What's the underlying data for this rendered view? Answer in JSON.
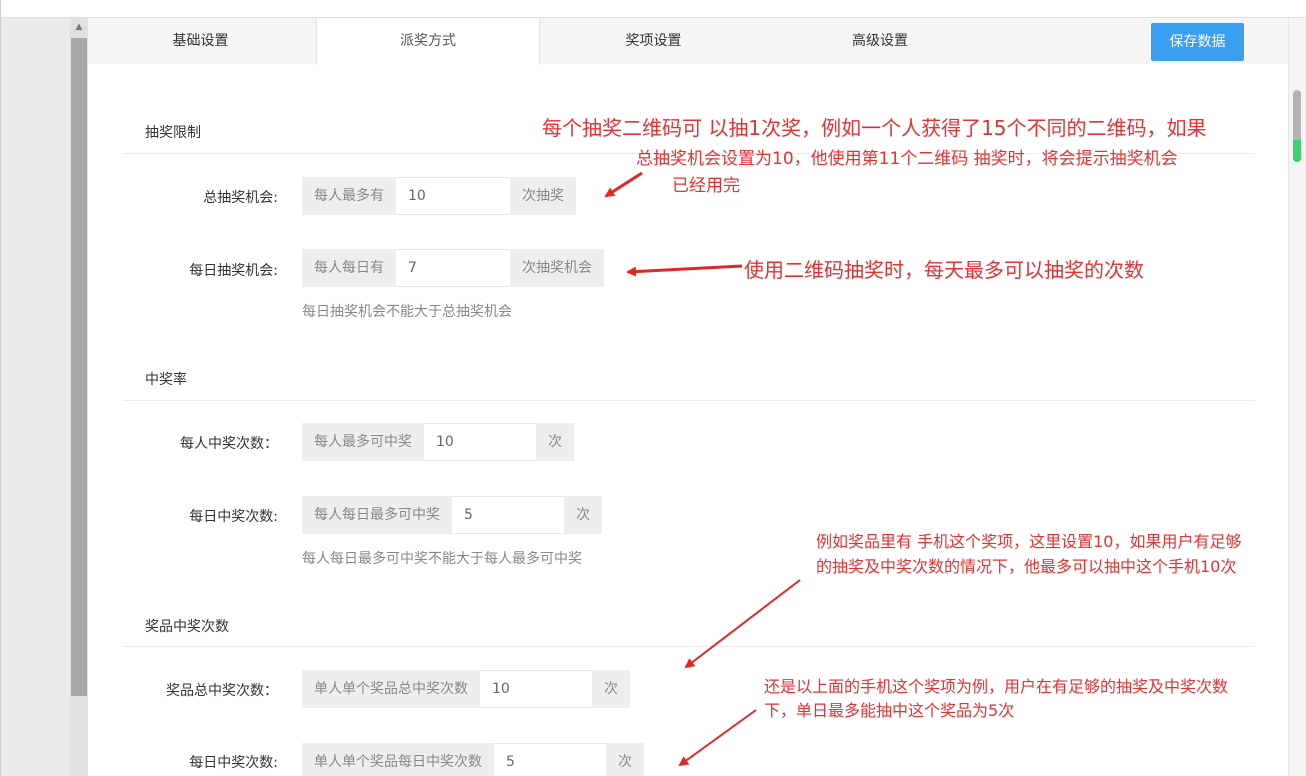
{
  "tabs": [
    {
      "label": "基础设置",
      "active": false
    },
    {
      "label": "派奖方式",
      "active": true
    },
    {
      "label": "奖项设置",
      "active": false
    },
    {
      "label": "高级设置",
      "active": false
    }
  ],
  "save_button": "保存数据",
  "sections": {
    "limit": {
      "title": "抽奖限制",
      "total": {
        "label": "总抽奖机会:",
        "prefix": "每人最多有",
        "value": "10",
        "suffix": "次抽奖"
      },
      "daily": {
        "label": "每日抽奖机会:",
        "prefix": "每人每日有",
        "value": "7",
        "suffix": "次抽奖机会",
        "hint": "每日抽奖机会不能大于总抽奖机会"
      }
    },
    "rate": {
      "title": "中奖率",
      "per_person": {
        "label": "每人中奖次数：",
        "prefix": "每人最多可中奖",
        "value": "10",
        "suffix": "次"
      },
      "daily": {
        "label": "每日中奖次数:",
        "prefix": "每人每日最多可中奖",
        "value": "5",
        "suffix": "次",
        "hint": "每人每日最多可中奖不能大于每人最多可中奖"
      }
    },
    "prize": {
      "title": "奖品中奖次数",
      "total": {
        "label": "奖品总中奖次数：",
        "prefix": "单人单个奖品总中奖次数",
        "value": "10",
        "suffix": "次"
      },
      "daily": {
        "label": "每日中奖次数:",
        "prefix": "单人单个奖品每日中奖次数",
        "value": "5",
        "suffix": "次"
      }
    }
  },
  "annotations": {
    "a1_line1": "每个抽奖二维码可 以抽1次奖，例如一个人获得了15个不同的二维码，如果",
    "a1_line2": "总抽奖机会设置为10，他使用第11个二维码 抽奖时，将会提示抽奖机会",
    "a1_line3": "已经用完",
    "a2": "使用二维码抽奖时，每天最多可以抽奖的次数",
    "a3_line1": "例如奖品里有 手机这个奖项，这里设置10，如果用户有足够",
    "a3_line2": "的抽奖及中奖次数的情况下，他最多可以抽中这个手机10次",
    "a4_line1": "还是以上面的手机这个奖项为例，用户在有足够的抽奖及中奖次数",
    "a4_line2": "下，单日最多能抽中这个奖品为5次"
  },
  "colors": {
    "accent": "#3a9ff0",
    "annotation": "#e43232"
  }
}
